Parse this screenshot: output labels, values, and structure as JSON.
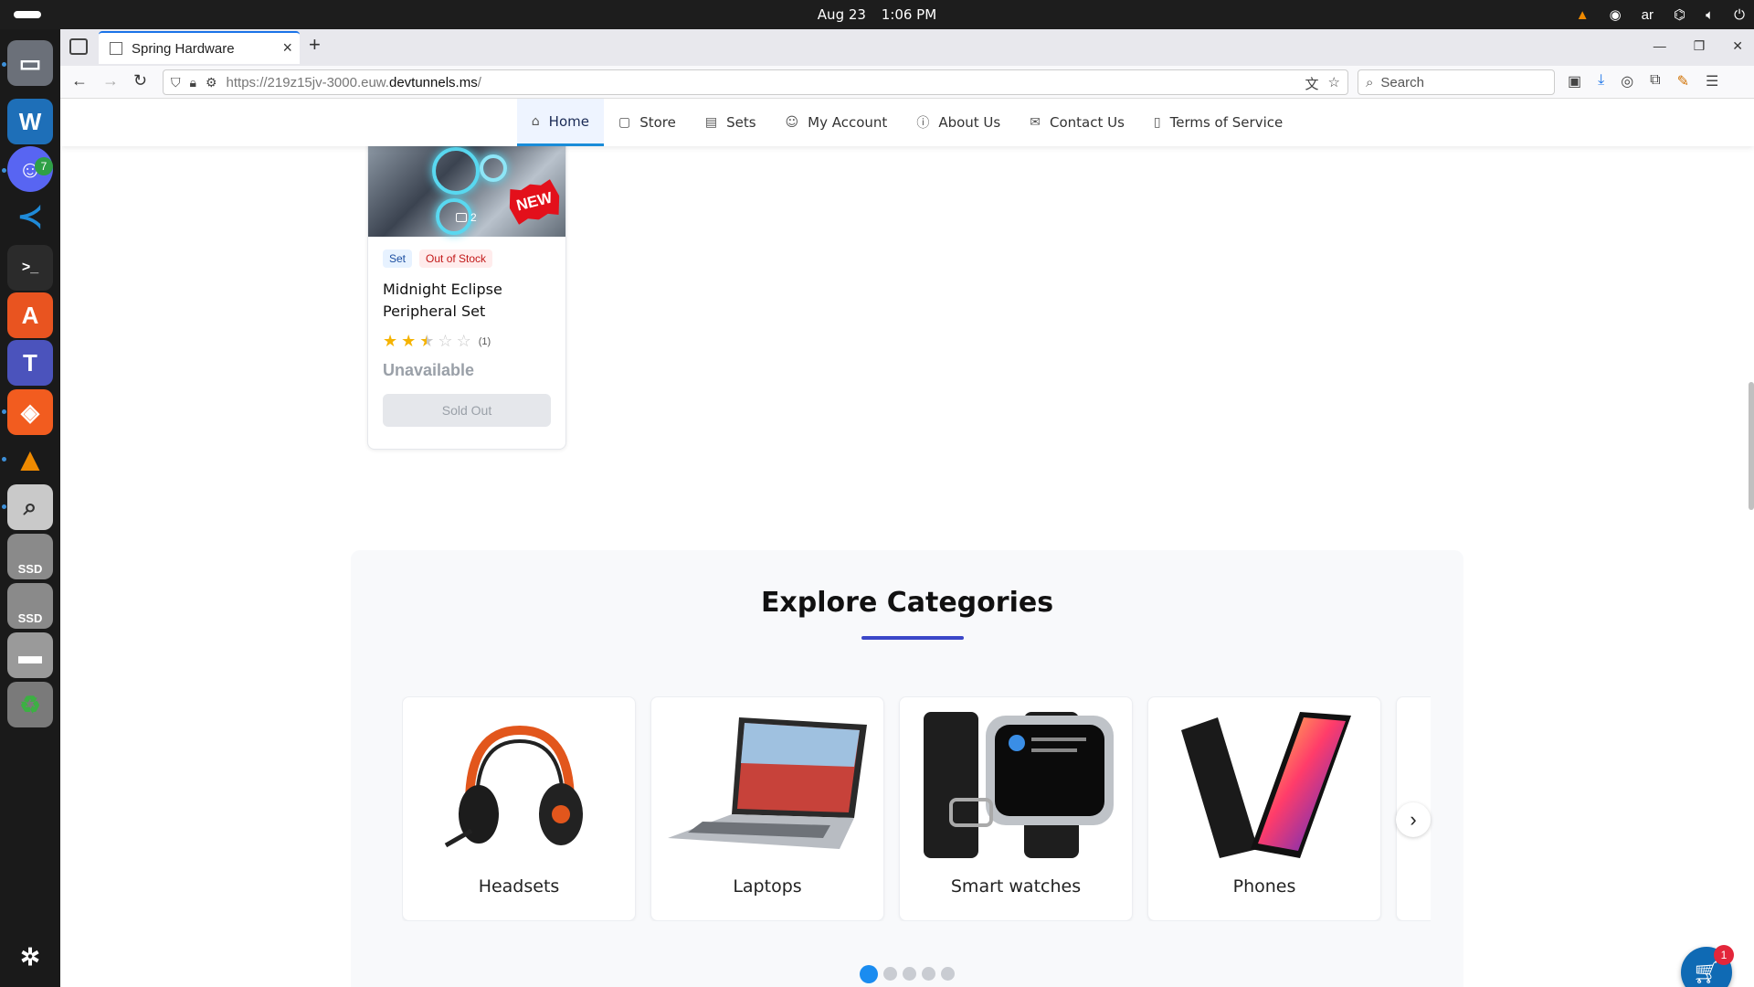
{
  "system": {
    "date": "Aug 23",
    "time": "1:06 PM",
    "keyboard_layout": "ar",
    "dock_badge": "7",
    "dock_ssd_label": "SSD"
  },
  "browser": {
    "tab_title": "Spring Hardware",
    "url_prefix": "https://219z15jv-3000.euw.",
    "url_domain": "devtunnels.ms",
    "url_suffix": "/",
    "search_placeholder": "Search"
  },
  "site_nav": {
    "items": [
      {
        "label": "Home",
        "icon": "home-icon"
      },
      {
        "label": "Store",
        "icon": "bag-icon"
      },
      {
        "label": "Sets",
        "icon": "list-icon"
      },
      {
        "label": "My Account",
        "icon": "user-icon"
      },
      {
        "label": "About Us",
        "icon": "info-icon"
      },
      {
        "label": "Contact Us",
        "icon": "mail-icon"
      },
      {
        "label": "Terms of Service",
        "icon": "document-icon"
      }
    ]
  },
  "product": {
    "image_count": "2",
    "new_badge": "NEW",
    "tag_set": "Set",
    "tag_stock": "Out of Stock",
    "name": "Midnight Eclipse Peripheral Set",
    "rating": 2.5,
    "rating_max": 5,
    "review_count": "(1)",
    "price_text": "Unavailable",
    "button_label": "Sold Out"
  },
  "categories": {
    "title": "Explore Categories",
    "items": [
      {
        "name": "Headsets"
      },
      {
        "name": "Laptops"
      },
      {
        "name": "Smart watches"
      },
      {
        "name": "Phones"
      }
    ],
    "pages": 5,
    "active_page": 1
  },
  "cart": {
    "count": "1"
  },
  "colors": {
    "accent": "#1a8cd8",
    "underline": "#3b47c8",
    "badge_red": "#e3101b",
    "cart_blue": "#0f6ab4"
  }
}
